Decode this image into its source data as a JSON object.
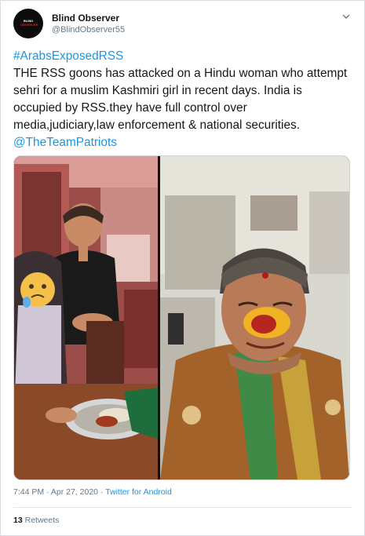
{
  "author": {
    "name": "Blind Observer",
    "handle": "@BlindObserver55",
    "avatar_text_line1": "BLIND",
    "avatar_text_line2": "OBSERVER"
  },
  "tweet": {
    "hashtag": "#ArabsExposedRSS",
    "text": "THE RSS goons has attacked on a Hindu woman who attempt sehri  for a muslim Kashmiri girl in recent days. India is occupied by RSS.they have full control over media,judiciary,law enforcement & national securities.",
    "mention": "@TheTeamPatriots"
  },
  "meta": {
    "time": "7:44 PM",
    "separator": "·",
    "date": "Apr 27, 2020",
    "via_separator": "·",
    "app": "Twitter for Android"
  },
  "stats": {
    "retweet_count": "13",
    "retweet_label": "Retweets"
  },
  "icons": {
    "menu": "chevron-down-icon",
    "emoji": "sad-face-emoji-icon"
  },
  "colors": {
    "link": "#1b95e0",
    "text": "#14171a",
    "secondary": "#657786"
  }
}
